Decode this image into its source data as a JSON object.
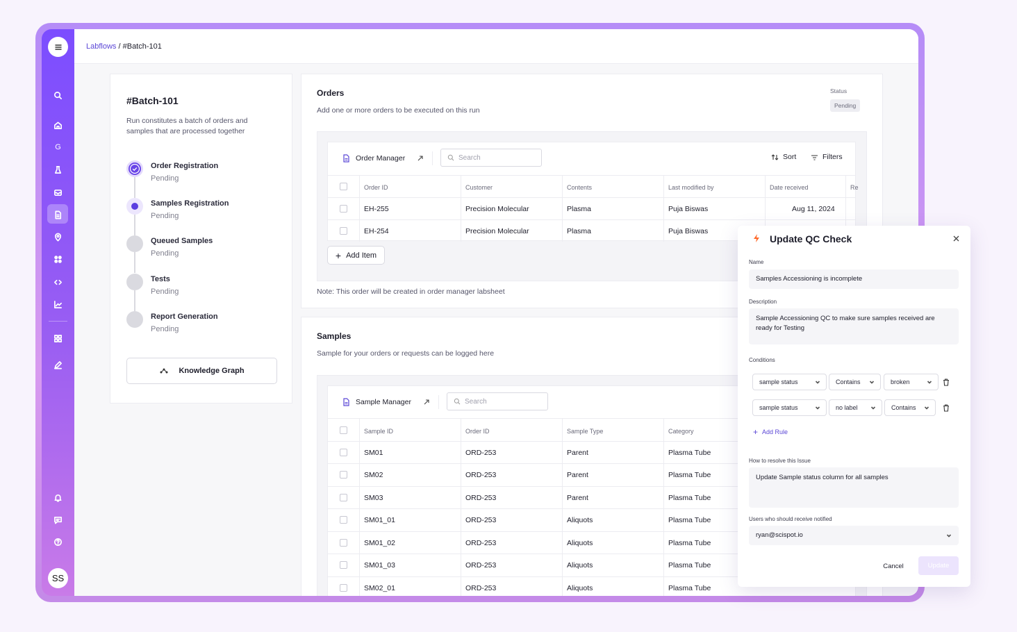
{
  "breadcrumb": {
    "root": "Labflows",
    "separator": "/",
    "current": "#Batch-101"
  },
  "sidebar": {
    "avatar_initials": "SS",
    "items": [
      "search",
      "home",
      "g",
      "flask",
      "inbox",
      "document",
      "location",
      "apps",
      "code",
      "chart",
      "grid",
      "pen",
      "bell",
      "chat",
      "help"
    ]
  },
  "batch": {
    "title": "#Batch-101",
    "description": "Run constitutes a batch of orders and samples that are processed together",
    "steps": [
      {
        "title": "Order Registration",
        "status": "Pending",
        "state": "done"
      },
      {
        "title": "Samples Registration",
        "status": "Pending",
        "state": "current"
      },
      {
        "title": "Queued Samples",
        "status": "Pending",
        "state": "todo"
      },
      {
        "title": "Tests",
        "status": "Pending",
        "state": "todo"
      },
      {
        "title": "Report Generation",
        "status": "Pending",
        "state": "todo"
      }
    ],
    "knowledge_graph_label": "Knowledge Graph"
  },
  "orders": {
    "title": "Orders",
    "subtitle": "Add one or more orders to be executed on this run",
    "status_label": "Status",
    "status_value": "Pending",
    "manager_label": "Order Manager",
    "search_placeholder": "Search",
    "sort_label": "Sort",
    "filters_label": "Filters",
    "columns": [
      "Order ID",
      "Customer",
      "Contents",
      "Last modified by",
      "Date received",
      "Re"
    ],
    "rows": [
      [
        "EH-255",
        "Precision Molecular",
        "Plasma",
        "Puja Biswas",
        "Aug 11, 2024"
      ],
      [
        "EH-254",
        "Precision Molecular",
        "Plasma",
        "Puja Biswas",
        ""
      ]
    ],
    "add_item_label": "Add Item",
    "note": "Note: This order will be created in order manager labsheet"
  },
  "samples": {
    "title": "Samples",
    "subtitle": "Sample for your orders or requests can be logged here",
    "manager_label": "Sample Manager",
    "search_placeholder": "Search",
    "columns": [
      "Sample ID",
      "Order ID",
      "Sample Type",
      "Category"
    ],
    "rows": [
      [
        "SM01",
        "ORD-253",
        "Parent",
        "Plasma Tube"
      ],
      [
        "SM02",
        "ORD-253",
        "Parent",
        "Plasma Tube"
      ],
      [
        "SM03",
        "ORD-253",
        "Parent",
        "Plasma Tube"
      ],
      [
        "SM01_01",
        "ORD-253",
        "Aliquots",
        "Plasma Tube"
      ],
      [
        "SM01_02",
        "ORD-253",
        "Aliquots",
        "Plasma Tube"
      ],
      [
        "SM01_03",
        "ORD-253",
        "Aliquots",
        "Plasma Tube"
      ],
      [
        "SM02_01",
        "ORD-253",
        "Aliquots",
        "Plasma Tube"
      ]
    ]
  },
  "qc_panel": {
    "title": "Update QC Check",
    "name_label": "Name",
    "name_value": "Samples Accessioning is incomplete",
    "description_label": "Description",
    "description_value": "Sample Accessioning QC to make sure samples received are ready for Testing",
    "conditions_label": "Conditions",
    "rule1": {
      "field": "sample status",
      "operator": "Contains",
      "value": "broken"
    },
    "rule2": {
      "field": "sample status",
      "operator": "no label",
      "value": "Contains"
    },
    "add_rule_label": "Add Rule",
    "resolve_label": "How to resolve this Issue",
    "resolve_value": "Update Sample status column for all samples",
    "notify_label": "Users who should receive notified",
    "notify_value": "ryan@scispot.io",
    "cancel_label": "Cancel",
    "update_label": "Update",
    "accent": "#7c4dff",
    "bolt_color": "#ff6a2b"
  }
}
